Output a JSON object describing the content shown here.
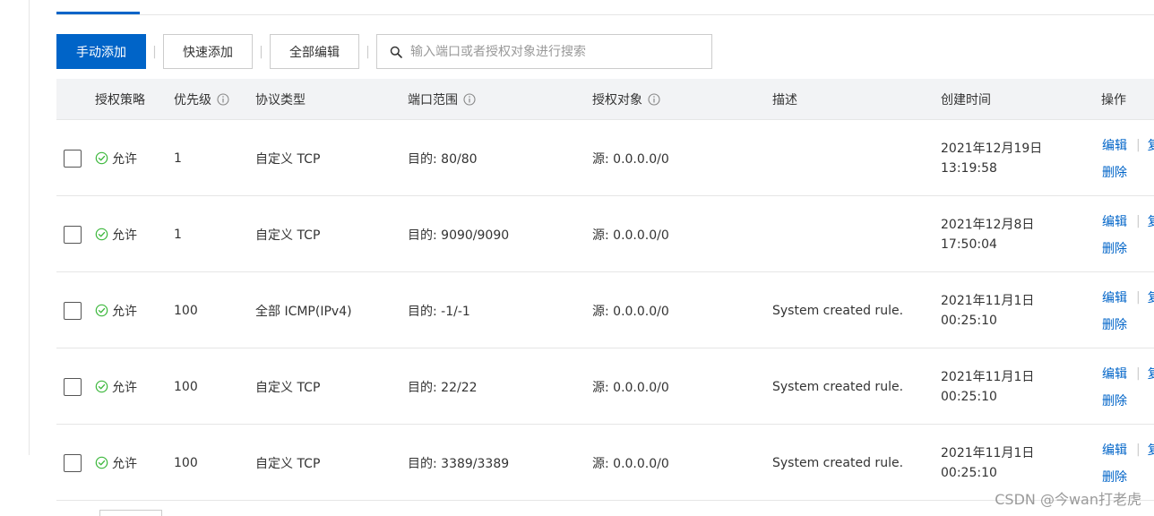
{
  "toolbar": {
    "manual_add": "手动添加",
    "quick_add": "快速添加",
    "edit_all": "全部编辑",
    "separator": "|",
    "search_placeholder": "输入端口或者授权对象进行搜索"
  },
  "table": {
    "headers": {
      "policy": "授权策略",
      "priority": "优先级",
      "protocol": "协议类型",
      "port_range": "端口范围",
      "auth_object": "授权对象",
      "description": "描述",
      "created": "创建时间",
      "actions": "操作"
    },
    "rows": [
      {
        "policy": "允许",
        "priority": "1",
        "protocol": "自定义 TCP",
        "port": "目的: 80/80",
        "source": "源: 0.0.0.0/0",
        "description": "",
        "date": "2021年12月19日",
        "time": "13:19:58"
      },
      {
        "policy": "允许",
        "priority": "1",
        "protocol": "自定义 TCP",
        "port": "目的: 9090/9090",
        "source": "源: 0.0.0.0/0",
        "description": "",
        "date": "2021年12月8日 17:50:04",
        "time": ""
      },
      {
        "policy": "允许",
        "priority": "100",
        "protocol": "全部 ICMP(IPv4)",
        "port": "目的: -1/-1",
        "source": "源: 0.0.0.0/0",
        "description": "System created rule.",
        "date": "2021年11月1日 00:25:10",
        "time": ""
      },
      {
        "policy": "允许",
        "priority": "100",
        "protocol": "自定义 TCP",
        "port": "目的: 22/22",
        "source": "源: 0.0.0.0/0",
        "description": "System created rule.",
        "date": "2021年11月1日 00:25:10",
        "time": ""
      },
      {
        "policy": "允许",
        "priority": "100",
        "protocol": "自定义 TCP",
        "port": "目的: 3389/3389",
        "source": "源: 0.0.0.0/0",
        "description": "System created rule.",
        "date": "2021年11月1日 00:25:10",
        "time": ""
      }
    ],
    "actions": {
      "edit": "编辑",
      "separator": "|",
      "copy": "复",
      "delete": "删除"
    }
  },
  "watermark": "CSDN @今wan打老虎",
  "colors": {
    "primary": "#0064c8",
    "success": "#3db83d",
    "header_bg": "#f2f3f5",
    "border": "#e6e6e6"
  },
  "icons": {
    "search": "search-icon",
    "info": "info-icon",
    "allow": "check-circle-icon"
  }
}
